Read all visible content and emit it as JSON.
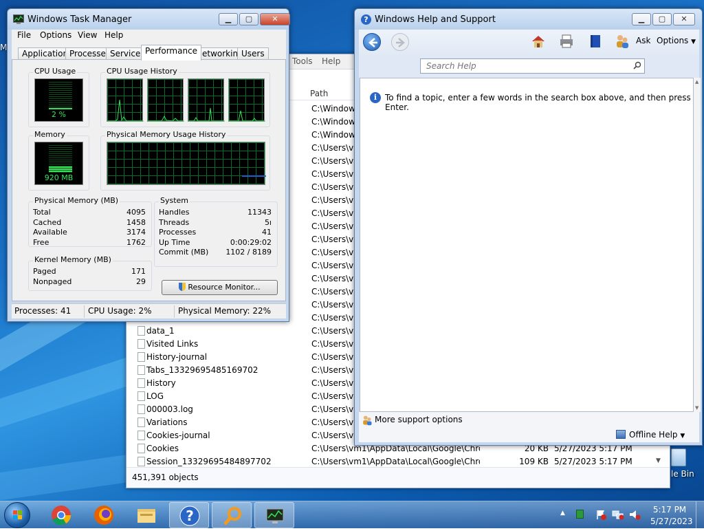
{
  "desktop": {
    "recycle_bin_label": "le Bin",
    "left_edge_label": "M"
  },
  "explorer": {
    "menu": [
      "Tools",
      "Help"
    ],
    "column_path": "Path",
    "rows_partial": [
      {
        "path": "C:\\Windows"
      },
      {
        "path": "C:\\Windows"
      },
      {
        "path": "C:\\Windows"
      },
      {
        "path": "C:\\Users\\vm"
      },
      {
        "path": "C:\\Users\\vm"
      },
      {
        "path": "C:\\Users\\vm"
      },
      {
        "path": "C:\\Users\\vm"
      },
      {
        "path": "C:\\Users\\vm"
      },
      {
        "path": "C:\\Users\\vm"
      },
      {
        "path": "C:\\Users\\vm"
      },
      {
        "path": "C:\\Users\\vm"
      },
      {
        "path": "C:\\Users\\vm"
      },
      {
        "path": "C:\\Users\\vm"
      },
      {
        "path": "C:\\Users\\vm"
      },
      {
        "path": "C:\\Users\\vm"
      },
      {
        "path": "C:\\Users\\vm"
      },
      {
        "path": "C:\\Users\\vm"
      }
    ],
    "rows": [
      {
        "name": "data_1",
        "path": "C:\\Users\\vm",
        "size": "",
        "date": ""
      },
      {
        "name": "Visited Links",
        "path": "C:\\Users\\vm",
        "size": "",
        "date": ""
      },
      {
        "name": "History-journal",
        "path": "C:\\Users\\vm",
        "size": "",
        "date": ""
      },
      {
        "name": "Tabs_13329695485169702",
        "path": "C:\\Users\\vm",
        "size": "",
        "date": ""
      },
      {
        "name": "History",
        "path": "C:\\Users\\vm",
        "size": "",
        "date": ""
      },
      {
        "name": "LOG",
        "path": "C:\\Users\\vm",
        "size": "",
        "date": ""
      },
      {
        "name": "000003.log",
        "path": "C:\\Users\\vm",
        "size": "",
        "date": ""
      },
      {
        "name": "Variations",
        "path": "C:\\Users\\vm",
        "size": "",
        "date": ""
      },
      {
        "name": "Cookies-journal",
        "path": "C:\\Users\\vm",
        "size": "",
        "date": ""
      },
      {
        "name": "Cookies",
        "path": "C:\\Users\\vm1\\AppData\\Local\\Google\\Chro...",
        "size": "20 KB",
        "date": "5/27/2023 5:17 PM"
      },
      {
        "name": "Session_13329695484897702",
        "path": "C:\\Users\\vm1\\AppData\\Local\\Google\\Chro...",
        "size": "109 KB",
        "date": "5/27/2023 5:17 PM"
      }
    ],
    "status": "451,391 objects"
  },
  "taskmgr": {
    "title": "Windows Task Manager",
    "menu": [
      "File",
      "Options",
      "View",
      "Help"
    ],
    "tabs": [
      "Applications",
      "Processes",
      "Services",
      "Performance",
      "Networking",
      "Users"
    ],
    "active_tab": "Performance",
    "cpu_usage_label": "CPU Usage",
    "cpu_usage_value": "2 %",
    "cpu_usage_fraction": 0.02,
    "cpu_history_label": "CPU Usage History",
    "memory_label": "Memory",
    "memory_value": "920 MB",
    "memory_fraction": 0.22,
    "mem_history_label": "Physical Memory Usage History",
    "physical_memory": {
      "label": "Physical Memory (MB)",
      "rows": [
        {
          "k": "Total",
          "v": "4095"
        },
        {
          "k": "Cached",
          "v": "1458"
        },
        {
          "k": "Available",
          "v": "3174"
        },
        {
          "k": "Free",
          "v": "1762"
        }
      ]
    },
    "kernel_memory": {
      "label": "Kernel Memory (MB)",
      "rows": [
        {
          "k": "Paged",
          "v": "171"
        },
        {
          "k": "Nonpaged",
          "v": "29"
        }
      ]
    },
    "system": {
      "label": "System",
      "rows": [
        {
          "k": "Handles",
          "v": "11343"
        },
        {
          "k": "Threads",
          "v": "5ı"
        },
        {
          "k": "Processes",
          "v": "41"
        },
        {
          "k": "Up Time",
          "v": "0:00:29:02"
        },
        {
          "k": "Commit (MB)",
          "v": "1102 / 8189"
        }
      ]
    },
    "resource_monitor_label": "Resource Monitor...",
    "status": {
      "processes": "Processes: 41",
      "cpu": "CPU Usage: 2%",
      "memory": "Physical Memory: 22%"
    }
  },
  "help": {
    "title": "Windows Help and Support",
    "ask_label": "Ask",
    "options_label": "Options",
    "search_placeholder": "Search Help",
    "info_text": "To find a topic, enter a few words in the search box above, and then press Enter.",
    "more_support": "More support options",
    "offline_help": "Offline Help"
  },
  "taskbar": {
    "time": "5:17 PM",
    "date": "5/27/2023"
  },
  "colors": {
    "graph_green": "#37e35a",
    "graph_grid": "#0b6b2e",
    "memory_line": "#1f5fd6"
  }
}
